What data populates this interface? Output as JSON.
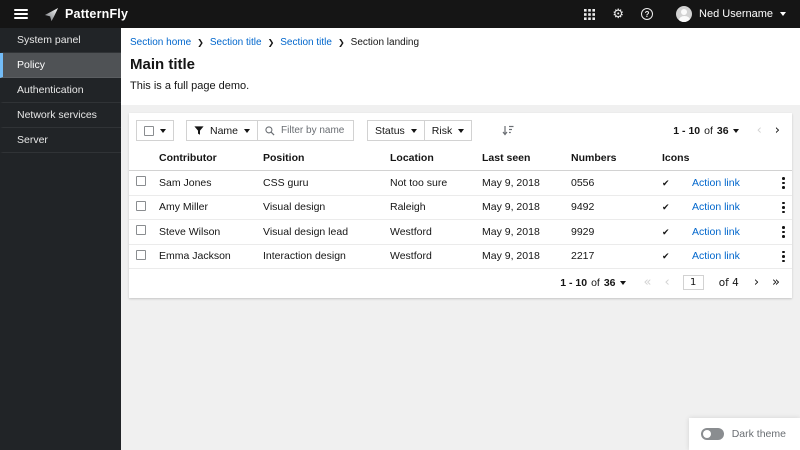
{
  "masthead": {
    "brand": "PatternFly",
    "user": "Ned Username",
    "settings_glyph": "⚙",
    "help_glyph": "?"
  },
  "sidebar": {
    "items": [
      {
        "label": "System panel"
      },
      {
        "label": "Policy"
      },
      {
        "label": "Authentication"
      },
      {
        "label": "Network services"
      },
      {
        "label": "Server"
      }
    ]
  },
  "breadcrumb": {
    "separator": "❯",
    "items": [
      {
        "label": "Section home"
      },
      {
        "label": "Section title"
      },
      {
        "label": "Section title"
      },
      {
        "label": "Section landing"
      }
    ]
  },
  "page": {
    "title": "Main title",
    "description": "This is a full page demo."
  },
  "toolbar": {
    "name_filter_label": "Name",
    "search_placeholder": "Filter by name",
    "status_label": "Status",
    "risk_label": "Risk"
  },
  "pagination": {
    "range": "1 - 10",
    "of_label": "of",
    "total": "36",
    "page": "1",
    "pages_label": "of 4",
    "first_glyph": "«",
    "prev_glyph": "‹",
    "next_glyph": "›",
    "last_glyph": "»"
  },
  "table": {
    "columns": [
      "Contributor",
      "Position",
      "Location",
      "Last seen",
      "Numbers",
      "Icons"
    ],
    "check_glyph": "✔",
    "action_label": "Action link",
    "rows": [
      {
        "contributor": "Sam Jones",
        "position": "CSS guru",
        "location": "Not too sure",
        "last_seen": "May 9, 2018",
        "numbers": "0556"
      },
      {
        "contributor": "Amy Miller",
        "position": "Visual design",
        "location": "Raleigh",
        "last_seen": "May 9, 2018",
        "numbers": "9492"
      },
      {
        "contributor": "Steve Wilson",
        "position": "Visual design lead",
        "location": "Westford",
        "last_seen": "May 9, 2018",
        "numbers": "9929"
      },
      {
        "contributor": "Emma Jackson",
        "position": "Interaction design",
        "location": "Westford",
        "last_seen": "May 9, 2018",
        "numbers": "2217"
      }
    ]
  },
  "theme_toggle": {
    "label": "Dark theme"
  },
  "colors": {
    "link": "#0066cc",
    "masthead_bg": "#151515",
    "sidebar_bg": "#212427",
    "sidebar_active_border": "#73bcf7",
    "content_bg": "#f0f0f0"
  }
}
